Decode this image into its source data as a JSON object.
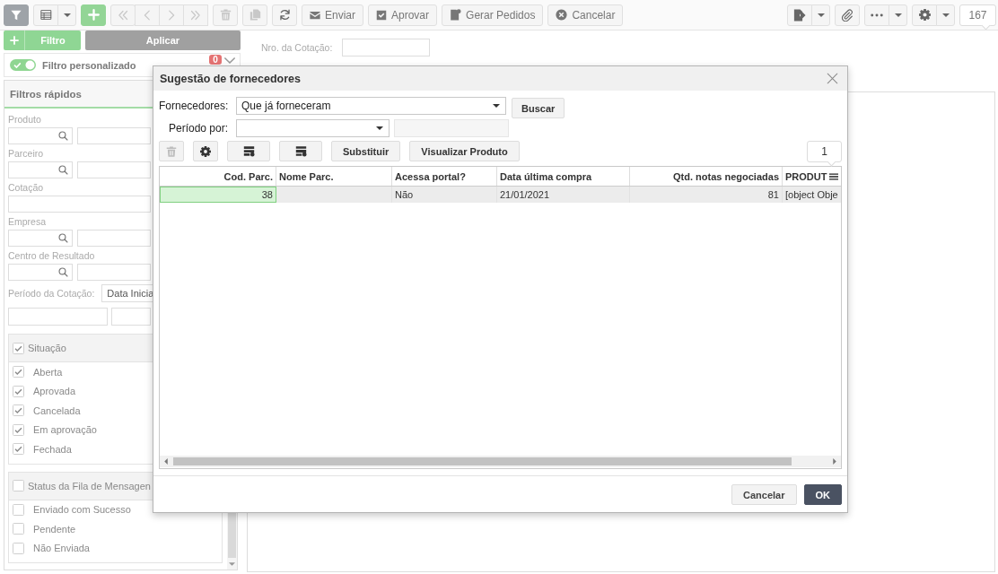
{
  "toolbar": {
    "filter_toggle": {
      "on": true
    },
    "left": [
      {
        "kind": "split",
        "disabled": false
      },
      {
        "kind": "add",
        "disabled": false
      },
      {
        "kind": "nav",
        "disabled": true
      },
      {
        "kind": "nav",
        "disabled": true
      },
      {
        "kind": "nav",
        "disabled": true
      },
      {
        "kind": "nav",
        "disabled": true
      },
      {
        "kind": "icon",
        "disabled": true
      },
      {
        "kind": "icon",
        "disabled": true
      },
      {
        "kind": "icon",
        "disabled": false
      },
      {
        "kind": "text",
        "label": "Enviar",
        "disabled": false
      },
      {
        "kind": "text",
        "label": "Aprovar",
        "disabled": false
      },
      {
        "kind": "text",
        "label": "Gerar Pedidos",
        "disabled": false
      },
      {
        "kind": "text",
        "label": "Cancelar",
        "disabled": false
      }
    ],
    "right": [
      {
        "kind": "split",
        "disabled": false
      },
      {
        "kind": "icon",
        "disabled": false
      },
      {
        "kind": "split",
        "disabled": false
      },
      {
        "kind": "split",
        "disabled": false
      },
      {
        "kind": "count",
        "label": "167"
      }
    ]
  },
  "sidebar": {
    "filter_button": "Filtro",
    "apply_button": "Aplicar",
    "custom_filter": {
      "label": "Filtro personalizado",
      "on": true,
      "count": "0"
    },
    "quick_filters": {
      "title": "Filtros rápidos",
      "fields": [
        {
          "label": "Produto",
          "kind": "lookup"
        },
        {
          "label": "Parceiro",
          "kind": "lookup"
        },
        {
          "label": "Cotação",
          "kind": "text"
        },
        {
          "label": "Empresa",
          "kind": "lookup"
        },
        {
          "label": "Centro de Resultado",
          "kind": "lookup"
        }
      ],
      "period": {
        "label": "Período da Cotação:",
        "value": "Data Inicia"
      },
      "groups": [
        {
          "title": "Situação",
          "checked": true,
          "options": [
            {
              "label": "Aberta",
              "checked": true
            },
            {
              "label": "Aprovada",
              "checked": true
            },
            {
              "label": "Cancelada",
              "checked": true
            },
            {
              "label": "Em aprovação",
              "checked": true
            },
            {
              "label": "Fechada",
              "checked": true
            }
          ]
        },
        {
          "title": "Status da Fila de Mensagen",
          "checked": false,
          "options": [
            {
              "label": "Enviado com Sucesso",
              "checked": false
            },
            {
              "label": "Pendente",
              "checked": false
            },
            {
              "label": "Não Enviada",
              "checked": false
            }
          ]
        }
      ]
    }
  },
  "main": {
    "quote_number": {
      "label": "Nro. da Cotação:"
    }
  },
  "dialog": {
    "title": "Sugestão de fornecedores",
    "suppliers": {
      "label": "Fornecedores:",
      "value": "Que já forneceram"
    },
    "search_button": "Buscar",
    "period": {
      "label": "Período por:"
    },
    "tools": [
      {
        "kind": "icon",
        "disabled": true
      },
      {
        "kind": "icon",
        "disabled": false
      },
      {
        "kind": "wide",
        "disabled": false
      },
      {
        "kind": "wide",
        "disabled": false
      },
      {
        "kind": "text",
        "label": "Substituir",
        "disabled": false
      },
      {
        "kind": "text",
        "label": "Visualizar Produto",
        "disabled": false
      }
    ],
    "page": "1",
    "table": {
      "columns": [
        {
          "label": "Cod. Parc.",
          "kind": "number"
        },
        {
          "label": "Nome Parc.",
          "kind": "text"
        },
        {
          "label": "Acessa portal?",
          "kind": "text"
        },
        {
          "label": "Data última compra",
          "kind": "text"
        },
        {
          "label": "Qtd. notas negociadas",
          "kind": "number"
        },
        {
          "label": "PRODUT",
          "kind": "text"
        }
      ],
      "rows": [
        {
          "selected": true,
          "cells": [
            "38",
            null,
            "Não",
            "21/01/2021",
            "81",
            "[object Obje"
          ]
        }
      ]
    },
    "buttons": [
      {
        "label": "Cancelar",
        "kind": "secondary"
      },
      {
        "label": "OK",
        "kind": "primary"
      }
    ]
  }
}
